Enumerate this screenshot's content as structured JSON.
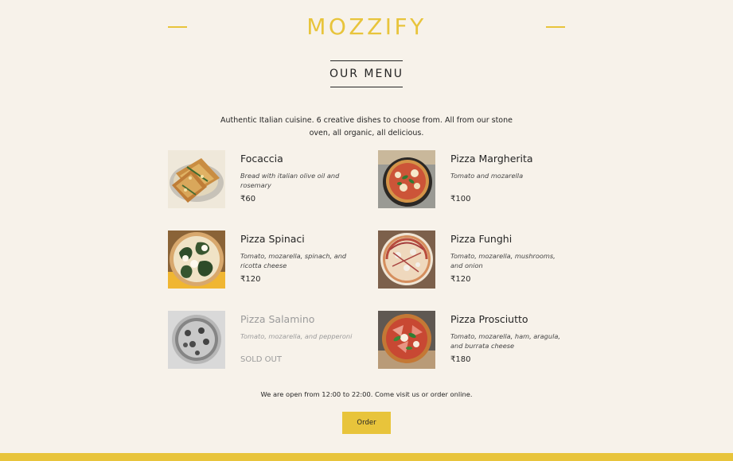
{
  "header": {
    "brand": "MOZZIFY"
  },
  "menu_section": {
    "title": "OUR MENU",
    "intro": "Authentic Italian cuisine. 6 creative dishes to choose from. All from our stone oven, all organic, all delicious."
  },
  "dishes": [
    {
      "name": "Focaccia",
      "description": "Bread with italian olive oil and rosemary",
      "price": "₹60",
      "sold_out": false
    },
    {
      "name": "Pizza Margherita",
      "description": "Tomato and mozarella",
      "price": "₹100",
      "sold_out": false
    },
    {
      "name": "Pizza Spinaci",
      "description": "Tomato, mozarella, spinach, and ricotta cheese",
      "price": "₹120",
      "sold_out": false
    },
    {
      "name": "Pizza Funghi",
      "description": "Tomato, mozarella, mushrooms, and onion",
      "price": "₹120",
      "sold_out": false
    },
    {
      "name": "Pizza Salamino",
      "description": "Tomato, mozarella, and pepperoni",
      "price": "SOLD OUT",
      "sold_out": true
    },
    {
      "name": "Pizza Prosciutto",
      "description": "Tomato, mozarella, ham, aragula, and burrata cheese",
      "price": "₹180",
      "sold_out": false
    }
  ],
  "footer": {
    "open_text": "We are open from 12:00 to 22:00. Come visit us or order online.",
    "order_label": "Order"
  },
  "colors": {
    "accent": "#e8c43b",
    "background": "#f7f2ea",
    "text": "#252525",
    "sold_out_text": "#9b9b9b"
  }
}
